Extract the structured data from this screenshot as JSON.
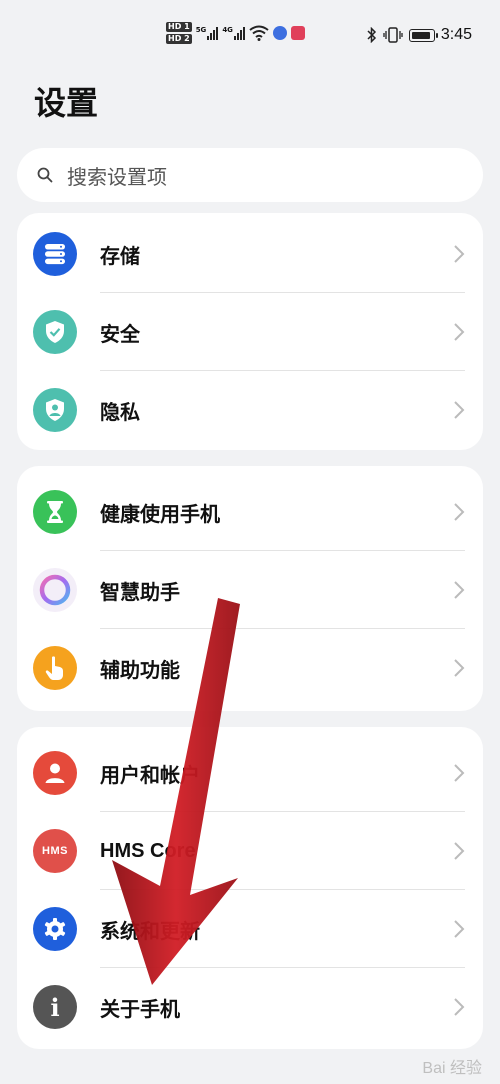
{
  "status_bar": {
    "hd1": "HD 1",
    "hd2": "HD 2",
    "net1": "5G",
    "net2": "4G",
    "time": "3:45"
  },
  "page": {
    "title": "设置"
  },
  "search": {
    "placeholder": "搜索设置项"
  },
  "groups": [
    {
      "items": [
        {
          "label": "存储",
          "icon": "storage-icon",
          "color": "#1f5fdc"
        },
        {
          "label": "安全",
          "icon": "shield-icon",
          "color": "#4ebfae"
        },
        {
          "label": "隐私",
          "icon": "privacy-icon",
          "color": "#4ebfae"
        }
      ]
    },
    {
      "items": [
        {
          "label": "健康使用手机",
          "icon": "hourglass-icon",
          "color": "#39c259"
        },
        {
          "label": "智慧助手",
          "icon": "assistant-ring-icon",
          "color": "#c86ee6"
        },
        {
          "label": "辅助功能",
          "icon": "hand-pointer-icon",
          "color": "#f5a21e"
        }
      ]
    },
    {
      "items": [
        {
          "label": "用户和帐户",
          "icon": "user-icon",
          "color": "#e54a3b"
        },
        {
          "label": "HMS Core",
          "icon": "hms-icon",
          "icon_text": "HMS",
          "color": "#e0504a"
        },
        {
          "label": "系统和更新",
          "icon": "gear-icon",
          "color": "#1f5fdc"
        },
        {
          "label": "关于手机",
          "icon": "info-icon",
          "icon_text": "i",
          "color": "#555555"
        }
      ]
    }
  ],
  "watermark": "Bai 经验"
}
